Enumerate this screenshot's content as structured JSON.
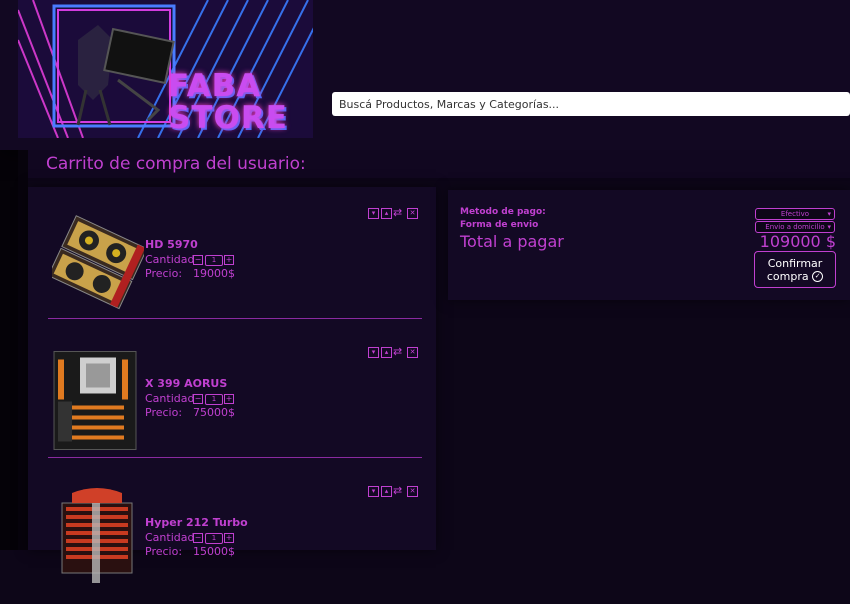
{
  "header": {
    "logo_line1": "FABA",
    "logo_line2": "STORE"
  },
  "search": {
    "placeholder": "Buscá Productos, Marcas y Categorías..."
  },
  "page_title": "Carrito de compra del usuario:",
  "cart": {
    "quantity_label": "Cantidad",
    "price_label": "Precio:",
    "items": [
      {
        "name": "HD 5970",
        "quantity": "1",
        "price": "19000$"
      },
      {
        "name": "X 399 AORUS",
        "quantity": "1",
        "price": "75000$"
      },
      {
        "name": "Hyper 212 Turbo",
        "quantity": "1",
        "price": "15000$"
      }
    ]
  },
  "summary": {
    "payment_label": "Metodo de pago:",
    "payment_value": "Efectivo",
    "shipping_label": "Forma de envio",
    "shipping_value": "Envio a domicilio",
    "total_label": "Total a pagar",
    "total_value": "109000 $",
    "confirm_line1": "Confirmar",
    "confirm_line2": "compra"
  },
  "colors": {
    "accent": "#c040d0",
    "background": "#0d0618",
    "panel": "#130924"
  }
}
